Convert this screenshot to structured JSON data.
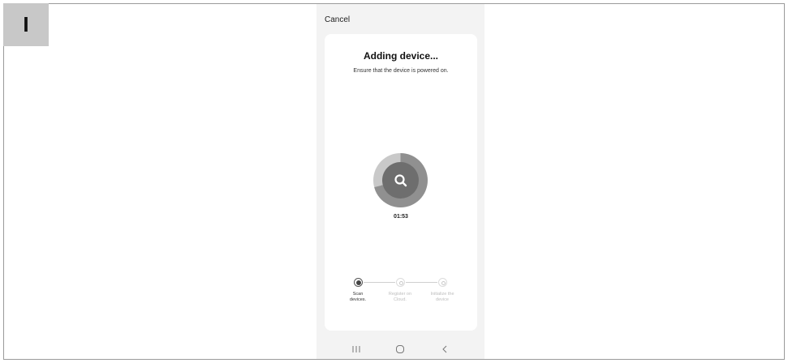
{
  "step_tag": "I",
  "header": {
    "cancel_label": "Cancel"
  },
  "card": {
    "title": "Adding device...",
    "subtitle": "Ensure that the device is powered on."
  },
  "scanner": {
    "icon": "search-icon",
    "timer": "01:53"
  },
  "progress": {
    "steps": [
      {
        "label_line1": "Scan",
        "label_line2": "devices.",
        "state": "active"
      },
      {
        "label_line1": "Register on",
        "label_line2": "Cloud.",
        "state": "pending"
      },
      {
        "label_line1": "Initialize the",
        "label_line2": "device",
        "state": "pending"
      }
    ]
  },
  "navbar": {
    "icons": [
      "recent-apps-icon",
      "home-icon",
      "back-icon"
    ]
  },
  "colors": {
    "ring_outer": "#909090",
    "ring_inner": "#6e6e6e",
    "background": "#f3f3f3",
    "card": "#ffffff"
  }
}
